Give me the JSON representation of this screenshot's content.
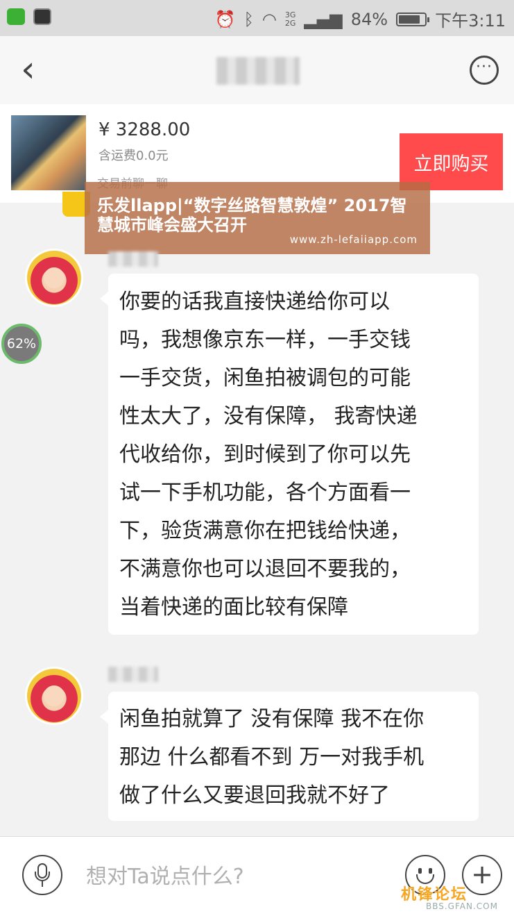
{
  "status_bar": {
    "signal_labels": [
      "3G",
      "2G"
    ],
    "battery": "84%",
    "battery_level": 0.84,
    "time": "下午3:11",
    "icons": [
      "wechat-icon",
      "gallery-icon",
      "alarm-icon",
      "bluetooth-icon",
      "wifi-icon",
      "signal-icon",
      "battery-icon"
    ]
  },
  "nav": {
    "back_glyph": "‹",
    "more_glyph": "···"
  },
  "product": {
    "price": "¥ 3288.00",
    "shipping": "含运费0.0元",
    "note": "交易前聊一聊",
    "buy_label": "立即购买",
    "buy_color": "#ff4b4b"
  },
  "watermark": {
    "title": "乐发llapp|“数字丝路智慧敦煌” 2017智慧城市峰会盛大召开",
    "url": "www.zh-lefaiiapp.com"
  },
  "progress": "62%",
  "messages": [
    {
      "lines": [
        " 你要的话我直接快递给你可以",
        "吗，我想像京东一样，一手交钱",
        "一手交货，闲鱼拍被调包的可能",
        "性太大了，没有保障， 我寄快递",
        "代收给你，到时候到了你可以先",
        "试一下手机功能，各个方面看一",
        "下，验货满意你在把钱给快递，",
        "不满意你也可以退回不要我的，",
        "当着快递的面比较有保障"
      ]
    },
    {
      "lines": [
        "闲鱼拍就算了 没有保障 我不在你",
        "那边 什么都看不到 万一对我手机",
        "做了什么又要退回我就不好了"
      ]
    }
  ],
  "input": {
    "placeholder": "想对Ta说点什么?"
  },
  "forum": {
    "brand": "机锋论坛",
    "site": "BBS.GFAN.COM"
  }
}
